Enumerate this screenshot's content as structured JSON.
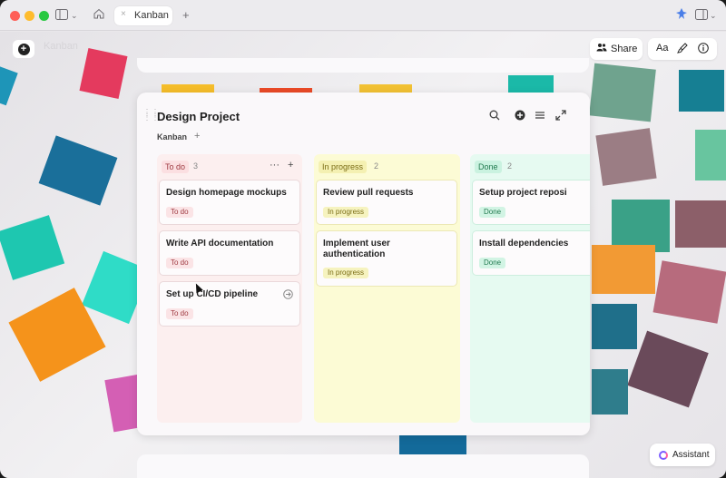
{
  "browser": {
    "tab_label": "Kanban",
    "tab_close": "×",
    "new_tab": "+"
  },
  "app": {
    "title": "Kanban",
    "share_label": "Share",
    "font_label": "Aa"
  },
  "board": {
    "title": "Design Project",
    "view_tab": "Kanban",
    "add_view": "+",
    "columns": [
      {
        "name": "To do",
        "count": "3",
        "cards": [
          {
            "title": "Design homepage mockups",
            "tag": "To do"
          },
          {
            "title": "Write API documentation",
            "tag": "To do"
          },
          {
            "title": "Set up CI/CD pipeline",
            "tag": "To do"
          }
        ]
      },
      {
        "name": "In progress",
        "count": "2",
        "cards": [
          {
            "title": "Review pull requests",
            "tag": "In progress"
          },
          {
            "title": "Implement user authentication",
            "tag": "In progress"
          }
        ]
      },
      {
        "name": "Done",
        "count": "2",
        "cards": [
          {
            "title": "Setup project reposi",
            "tag": "Done"
          },
          {
            "title": "Install dependencies",
            "tag": "Done"
          }
        ]
      }
    ]
  },
  "assistant": {
    "label": "Assistant"
  },
  "colors": {
    "todo": "#fcefef",
    "in_progress": "#fcfbd5",
    "done": "#e6faf1"
  }
}
